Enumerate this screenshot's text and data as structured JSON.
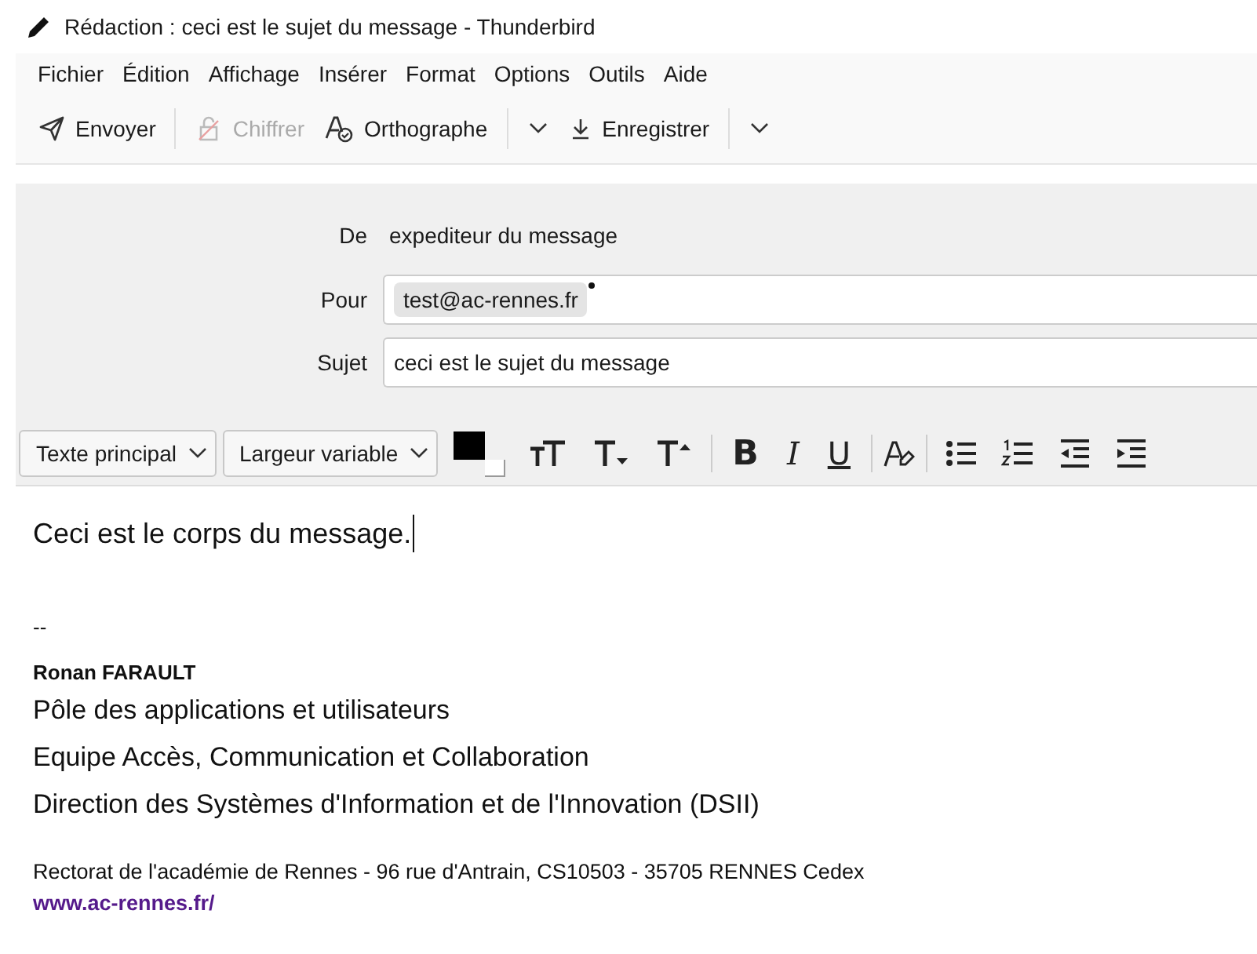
{
  "window": {
    "title": "Rédaction : ceci est le sujet du message - Thunderbird"
  },
  "menu": [
    {
      "label": "Fichier"
    },
    {
      "label": "Édition"
    },
    {
      "label": "Affichage"
    },
    {
      "label": "Insérer"
    },
    {
      "label": "Format"
    },
    {
      "label": "Options"
    },
    {
      "label": "Outils"
    },
    {
      "label": "Aide"
    }
  ],
  "toolbar": [
    {
      "label": "Envoyer",
      "disabled": false,
      "dropdown": false
    },
    {
      "label": "Chiffrer",
      "disabled": true,
      "dropdown": false
    },
    {
      "label": "Orthographe",
      "disabled": false,
      "dropdown": true
    },
    {
      "label": "Enregistrer",
      "disabled": false,
      "dropdown": true
    }
  ],
  "header": {
    "from": {
      "label": "De",
      "value": "expediteur du message"
    },
    "to": {
      "label": "Pour",
      "recipients": [
        "test@ac-rennes.fr"
      ]
    },
    "subject": {
      "label": "Sujet",
      "value": "ceci est le sujet du message"
    }
  },
  "format_bar": {
    "paragraph_format": "Texte principal",
    "font": "Largeur variable",
    "style_buttons": [
      {
        "kind": "bold",
        "label": "B"
      },
      {
        "kind": "italic",
        "label": "I"
      },
      {
        "kind": "underline",
        "label": "U"
      }
    ]
  },
  "body": {
    "text": "Ceci est le corps du message.",
    "signature": {
      "separator": "--",
      "name": "Ronan FARAULT",
      "lines": [
        "Pôle des applications et utilisateurs",
        "Equipe Accès, Communication et Collaboration",
        "Direction des Systèmes d'Information et de l'Innovation (DSII)"
      ],
      "address": "Rectorat de l'académie de Rennes - 96 rue d'Antrain, CS10503 - 35705 RENNES Cedex",
      "link": "www.ac-rennes.fr/"
    }
  }
}
